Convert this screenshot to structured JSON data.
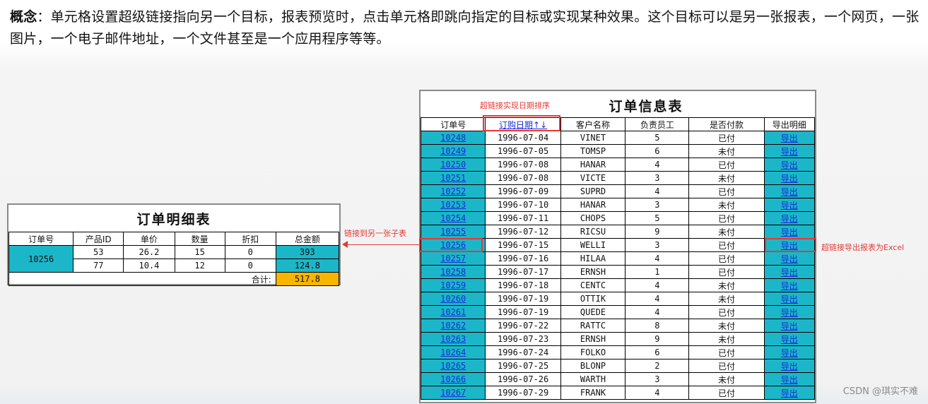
{
  "intro": {
    "lead": "概念",
    "text": "：单元格设置超级链接指向另一个目标，报表预览时，点击单元格即跳向指定的目标或实现某种效果。这个目标可以是另一张报表，一个网页，一张图片，一个电子邮件地址，一个文件甚至是一个应用程序等等。"
  },
  "detail": {
    "title": "订单明细表",
    "headers": [
      "订单号",
      "产品ID",
      "单价",
      "数量",
      "折扣",
      "总金额"
    ],
    "order_no": "10256",
    "rows": [
      [
        "53",
        "26.2",
        "15",
        "0",
        "393"
      ],
      [
        "77",
        "10.4",
        "12",
        "0",
        "124.8"
      ]
    ],
    "total_label": "合计:",
    "total_value": "517.8"
  },
  "order": {
    "title": "订单信息表",
    "sort_note": "超链接实现日期排序",
    "headers": [
      "订单号",
      "订购日期↑↓",
      "客户名称",
      "负责员工",
      "是否付款",
      "导出明细"
    ],
    "export_label": "导出",
    "rows": [
      [
        "10248",
        "1996-07-04",
        "VINET",
        "5",
        "已付"
      ],
      [
        "10249",
        "1996-07-05",
        "TOMSP",
        "6",
        "未付"
      ],
      [
        "10250",
        "1996-07-08",
        "HANAR",
        "4",
        "已付"
      ],
      [
        "10251",
        "1996-07-08",
        "VICTE",
        "3",
        "未付"
      ],
      [
        "10252",
        "1996-07-09",
        "SUPRD",
        "4",
        "已付"
      ],
      [
        "10253",
        "1996-07-10",
        "HANAR",
        "3",
        "未付"
      ],
      [
        "10254",
        "1996-07-11",
        "CHOPS",
        "5",
        "已付"
      ],
      [
        "10255",
        "1996-07-12",
        "RICSU",
        "9",
        "未付"
      ],
      [
        "10256",
        "1996-07-15",
        "WELLI",
        "3",
        "已付"
      ],
      [
        "10257",
        "1996-07-16",
        "HILAA",
        "4",
        "已付"
      ],
      [
        "10258",
        "1996-07-17",
        "ERNSH",
        "1",
        "已付"
      ],
      [
        "10259",
        "1996-07-18",
        "CENTC",
        "4",
        "未付"
      ],
      [
        "10260",
        "1996-07-19",
        "OTTIK",
        "4",
        "未付"
      ],
      [
        "10261",
        "1996-07-19",
        "QUEDE",
        "4",
        "已付"
      ],
      [
        "10262",
        "1996-07-22",
        "RATTC",
        "8",
        "未付"
      ],
      [
        "10263",
        "1996-07-23",
        "ERNSH",
        "9",
        "未付"
      ],
      [
        "10264",
        "1996-07-24",
        "FOLKO",
        "6",
        "已付"
      ],
      [
        "10265",
        "1996-07-25",
        "BLONP",
        "2",
        "已付"
      ],
      [
        "10266",
        "1996-07-26",
        "WARTH",
        "3",
        "未付"
      ],
      [
        "10267",
        "1996-07-29",
        "FRANK",
        "4",
        "已付"
      ]
    ]
  },
  "annotations": {
    "link_subreport": "链接到另一张子表",
    "export_excel": "超链接导出报表为Excel"
  },
  "watermark": "CSDN @琪实不难"
}
